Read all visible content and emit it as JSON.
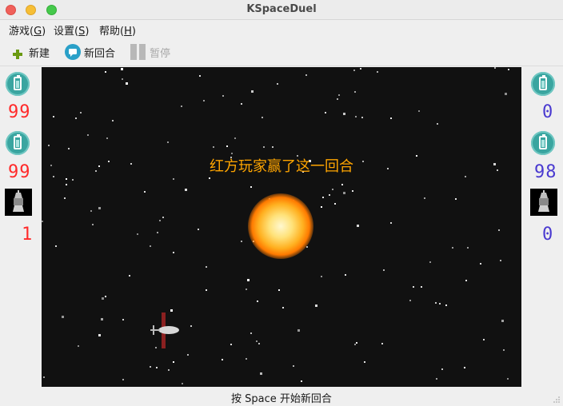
{
  "window": {
    "title": "KSpaceDuel"
  },
  "menubar": {
    "items": [
      {
        "label": "游戏(G)",
        "base": "游戏(",
        "mnemonic": "G",
        "close": ")"
      },
      {
        "label": "设置(S)",
        "base": "设置(",
        "mnemonic": "S",
        "close": ")"
      },
      {
        "label": "帮助(H)",
        "base": "帮助(",
        "mnemonic": "H",
        "close": ")"
      }
    ]
  },
  "toolbar": {
    "new_label": "新建",
    "new_round_label": "新回合",
    "pause_label": "暂停"
  },
  "left_player": {
    "energy": "99",
    "hitpoints": "99",
    "wins": "1",
    "color": "#ff2a2a"
  },
  "right_player": {
    "energy": "0",
    "hitpoints": "98",
    "wins": "0",
    "color": "#4a3ad0"
  },
  "arena": {
    "message": "红方玩家赢了这一回合"
  },
  "status": {
    "text": "按 Space 开始新回合"
  },
  "icons": {
    "energy": "battery-icon",
    "ship": "ship-icon",
    "new": "plus-icon",
    "new_round": "chat-bubble-icon",
    "pause": "pause-icon"
  }
}
